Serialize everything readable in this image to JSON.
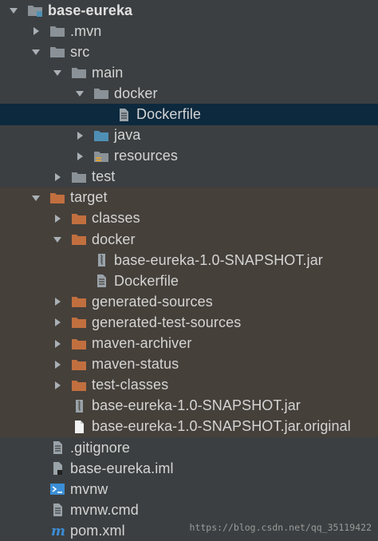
{
  "tree": {
    "root": {
      "label": "base-eureka",
      "icon": "module-folder-icon",
      "expanded": true
    },
    "mvn": {
      "label": ".mvn",
      "icon": "folder-icon",
      "expanded": false
    },
    "src": {
      "label": "src",
      "icon": "folder-icon",
      "expanded": true
    },
    "main": {
      "label": "main",
      "icon": "folder-icon",
      "expanded": true
    },
    "docker_src": {
      "label": "docker",
      "icon": "folder-icon",
      "expanded": true
    },
    "dockerfile_src": {
      "label": "Dockerfile",
      "icon": "text-file-icon",
      "selected": true
    },
    "java": {
      "label": "java",
      "icon": "source-folder-icon",
      "expanded": false
    },
    "resources": {
      "label": "resources",
      "icon": "resources-folder-icon",
      "expanded": false
    },
    "test": {
      "label": "test",
      "icon": "folder-icon",
      "expanded": false
    },
    "target": {
      "label": "target",
      "icon": "excluded-folder-icon",
      "expanded": true
    },
    "classes": {
      "label": "classes",
      "icon": "excluded-folder-icon",
      "expanded": false
    },
    "docker_target": {
      "label": "docker",
      "icon": "excluded-folder-icon",
      "expanded": true
    },
    "jar_docker": {
      "label": "base-eureka-1.0-SNAPSHOT.jar",
      "icon": "archive-file-icon"
    },
    "dockerfile_target": {
      "label": "Dockerfile",
      "icon": "text-file-icon"
    },
    "generated_sources": {
      "label": "generated-sources",
      "icon": "excluded-folder-icon",
      "expanded": false
    },
    "generated_test_sources": {
      "label": "generated-test-sources",
      "icon": "excluded-folder-icon",
      "expanded": false
    },
    "maven_archiver": {
      "label": "maven-archiver",
      "icon": "excluded-folder-icon",
      "expanded": false
    },
    "maven_status": {
      "label": "maven-status",
      "icon": "excluded-folder-icon",
      "expanded": false
    },
    "test_classes": {
      "label": "test-classes",
      "icon": "excluded-folder-icon",
      "expanded": false
    },
    "jar_target": {
      "label": "base-eureka-1.0-SNAPSHOT.jar",
      "icon": "archive-file-icon"
    },
    "jar_original": {
      "label": "base-eureka-1.0-SNAPSHOT.jar.original",
      "icon": "blank-file-icon"
    },
    "gitignore": {
      "label": ".gitignore",
      "icon": "text-file-icon"
    },
    "iml": {
      "label": "base-eureka.iml",
      "icon": "module-file-icon"
    },
    "mvnw": {
      "label": "mvnw",
      "icon": "shell-script-icon"
    },
    "mvnw_cmd": {
      "label": "mvnw.cmd",
      "icon": "text-file-icon"
    },
    "pom": {
      "label": "pom.xml",
      "icon": "maven-icon"
    }
  },
  "watermark": "https://blog.csdn.net/qq_35119422",
  "colors": {
    "background": "#3c3f41",
    "selected_row": "#0d293e",
    "excluded_region": "#45403a",
    "folder_grey": "#8a9298",
    "folder_orange": "#c16f3f",
    "folder_blue": "#4f8fb5"
  }
}
